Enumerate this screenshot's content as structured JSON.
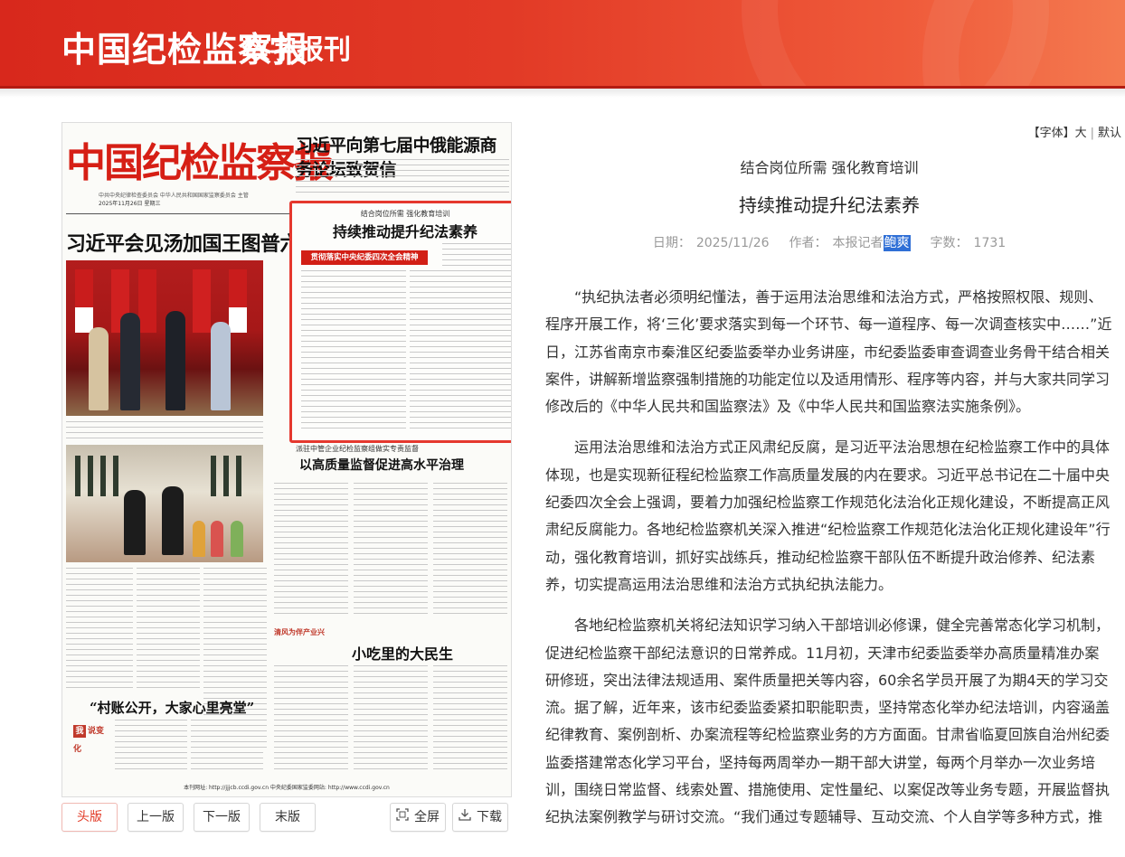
{
  "header": {
    "brand": "中国纪检监察报",
    "subtitle": "数字报刊"
  },
  "paper": {
    "masthead": "中国纪检监察报",
    "masthead_small": "中共中央纪律检查委员会  中华人民共和国国家监察委员会  主管",
    "masthead_date": "2025年11月26日  星期三",
    "headline_top": "习近平向第七届中俄能源商务论坛致贺信",
    "headline_left": "习近平会见汤加国王图普六世",
    "highlight_kicker": "结合岗位所需 强化教育培训",
    "highlight_title": "持续推动提升纪法素养",
    "highlight_banner": "贯彻落实中央纪委四次全会精神",
    "kicker3": "派驻中管企业纪检监察组做实专责监督",
    "headline3": "以高质量监督促进高水平治理",
    "column_tag": "清风为伴产业兴",
    "headline4": "小吃里的大民生",
    "headline5": "“村账公开，大家心里亮堂”",
    "badge_wo": "我",
    "badge_text": "说变化",
    "footer": "本刊网址: http://jjjcb.ccdi.gov.cn    中央纪委国家监委网站: http://www.ccdi.gov.cn"
  },
  "nav": {
    "first": "头版",
    "prev": "上一版",
    "next": "下一版",
    "last": "末版",
    "fullscreen": "全屏",
    "download": "下载"
  },
  "font_size": {
    "label": "【字体】",
    "large": "大",
    "default": "默认"
  },
  "article": {
    "kicker": "结合岗位所需 强化教育培训",
    "title": "持续推动提升纪法素养",
    "date_label": "日期：",
    "date": "2025/11/26",
    "author_label": "作者：",
    "author_prefix": "本报记者",
    "author_name": "鲍爽",
    "words_label": "字数：",
    "words": "1731",
    "paragraphs": [
      "“执纪执法者必须明纪懂法，善于运用法治思维和法治方式，严格按照权限、规则、程序开展工作，将‘三化’要求落实到每一个环节、每一道程序、每一次调查核实中……”近日，江苏省南京市秦淮区纪委监委举办业务讲座，市纪委监委审查调查业务骨干结合相关案件，讲解新增监察强制措施的功能定位以及适用情形、程序等内容，并与大家共同学习修改后的《中华人民共和国监察法》及《中华人民共和国监察法实施条例》。",
      "运用法治思维和法治方式正风肃纪反腐，是习近平法治思想在纪检监察工作中的具体体现，也是实现新征程纪检监察工作高质量发展的内在要求。习近平总书记在二十届中央纪委四次全会上强调，要着力加强纪检监察工作规范化法治化正规化建设，不断提高正风肃纪反腐能力。各地纪检监察机关深入推进“纪检监察工作规范化法治化正规化建设年”行动，强化教育培训，抓好实战练兵，推动纪检监察干部队伍不断提升政治修养、纪法素养，切实提高运用法治思维和法治方式执纪执法能力。",
      "各地纪检监察机关将纪法知识学习纳入干部培训必修课，健全完善常态化学习机制，促进纪检监察干部纪法意识的日常养成。11月初，天津市纪委监委举办高质量精准办案研修班，突出法律法规适用、案件质量把关等内容，60余名学员开展了为期4天的学习交流。据了解，近年来，该市纪委监委紧扣职能职责，坚持常态化举办纪法培训，内容涵盖纪律教育、案例剖析、办案流程等纪检监察业务的方方面面。甘肃省临夏回族自治州纪委监委搭建常态化学习平台，坚持每两周举办一期干部大讲堂，每两个月举办一次业务培训，围绕日常监督、线索处置、措施使用、定性量纪、以案促改等业务专题，开展监督执纪执法案例教学与研讨交流。“我们通过专题辅导、互动交流、个人自学等多种方式，推"
    ]
  }
}
